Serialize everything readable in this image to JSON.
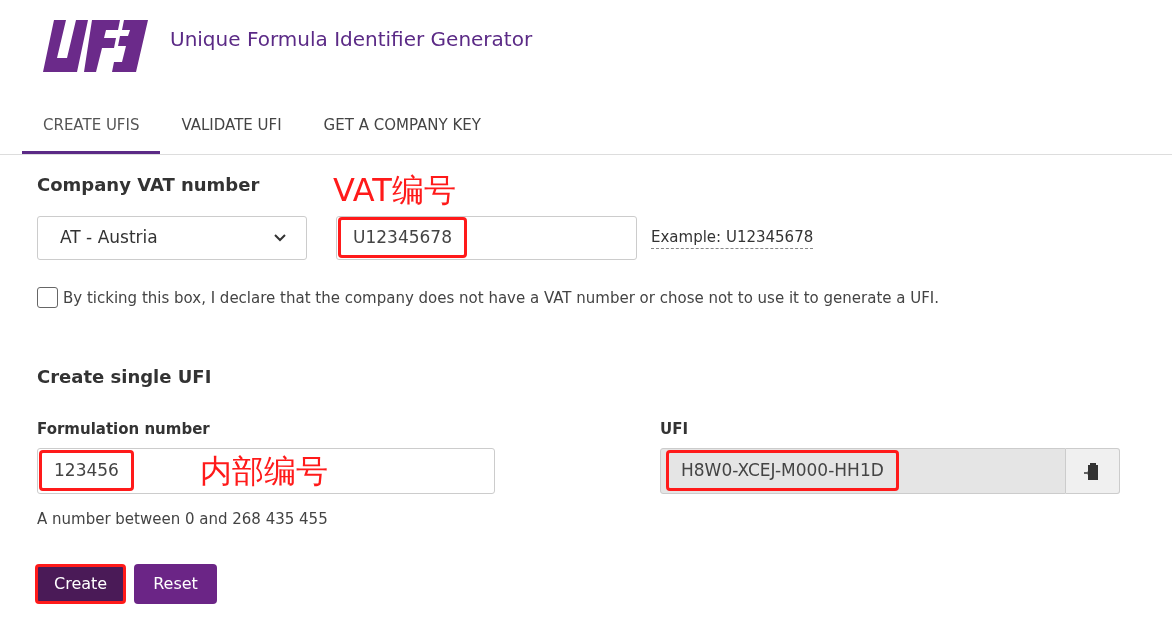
{
  "header": {
    "title": "Unique Formula Identifier Generator"
  },
  "tabs": [
    {
      "label": "CREATE UFIS",
      "selected": true
    },
    {
      "label": "VALIDATE UFI",
      "selected": false
    },
    {
      "label": "GET A COMPANY KEY",
      "selected": false
    }
  ],
  "vat_section": {
    "heading": "Company VAT number",
    "annotation": "VAT编号",
    "country": "AT - Austria",
    "vat_value": "U12345678",
    "vat_highlighted": true,
    "example": "Example: U12345678",
    "checkbox": {
      "label": "By ticking this box, I declare that the company does not have a VAT number or chose not to use it to generate a UFI.",
      "checked": false
    }
  },
  "single_section": {
    "heading": "Create single UFI",
    "formulation_label": "Formulation number",
    "formulation_value": "123456",
    "formulation_highlighted": true,
    "annotation": "内部编号",
    "help": "A number between 0 and 268 435 455",
    "ufi_label": "UFI",
    "ufi_value": "H8W0-XCEJ-M000-HH1D",
    "ufi_highlighted": true
  },
  "buttons": [
    {
      "label": "Create",
      "kind": "primary",
      "highlighted": true
    },
    {
      "label": "Reset",
      "kind": "secondary",
      "highlighted": false
    }
  ]
}
